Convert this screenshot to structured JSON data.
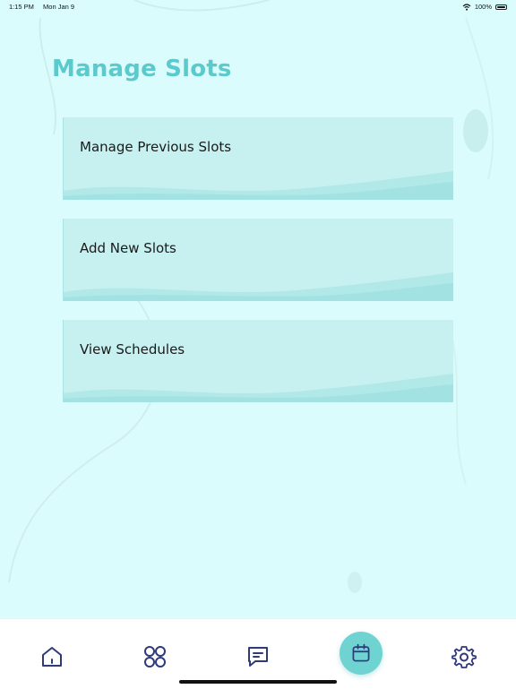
{
  "status_bar": {
    "time": "1:15 PM",
    "date": "Mon Jan 9",
    "battery": "100%",
    "icons": [
      "wifi-icon",
      "battery-icon"
    ]
  },
  "page": {
    "title": "Manage Slots"
  },
  "slots": [
    {
      "label": "Manage Previous Slots"
    },
    {
      "label": "Add New Slots"
    },
    {
      "label": "View Schedules"
    }
  ],
  "tab_bar": {
    "tabs": [
      {
        "icon": "home-icon"
      },
      {
        "icon": "grid-icon"
      },
      {
        "icon": "chat-icon"
      },
      {
        "icon": "calendar-icon",
        "active": true
      },
      {
        "icon": "gear-icon"
      }
    ]
  },
  "colors": {
    "background": "#dafcfc",
    "title": "#5cc9cc",
    "card": "#c7f0f0",
    "accent": "#6fd3d1",
    "icon": "#2f3a7a"
  }
}
